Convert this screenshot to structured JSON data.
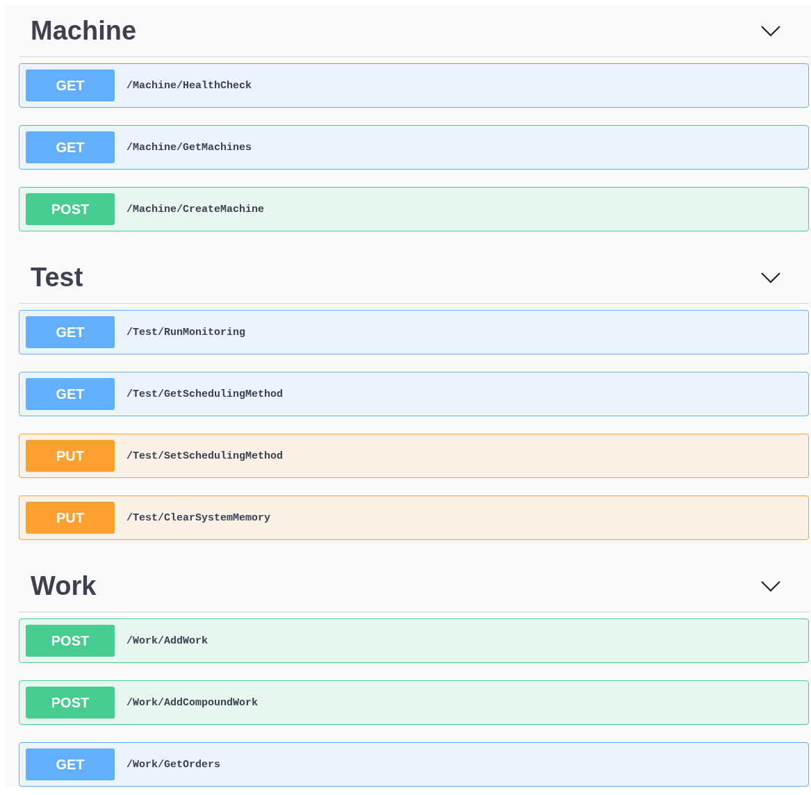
{
  "sections": [
    {
      "title": "Machine",
      "expanded": true,
      "endpoints": [
        {
          "method": "GET",
          "path": "/Machine/HealthCheck"
        },
        {
          "method": "GET",
          "path": "/Machine/GetMachines"
        },
        {
          "method": "POST",
          "path": "/Machine/CreateMachine"
        }
      ]
    },
    {
      "title": "Test",
      "expanded": true,
      "endpoints": [
        {
          "method": "GET",
          "path": "/Test/RunMonitoring"
        },
        {
          "method": "GET",
          "path": "/Test/GetSchedulingMethod"
        },
        {
          "method": "PUT",
          "path": "/Test/SetSchedulingMethod"
        },
        {
          "method": "PUT",
          "path": "/Test/ClearSystemMemory"
        }
      ]
    },
    {
      "title": "Work",
      "expanded": true,
      "endpoints": [
        {
          "method": "POST",
          "path": "/Work/AddWork"
        },
        {
          "method": "POST",
          "path": "/Work/AddCompoundWork"
        },
        {
          "method": "GET",
          "path": "/Work/GetOrders"
        }
      ]
    }
  ]
}
